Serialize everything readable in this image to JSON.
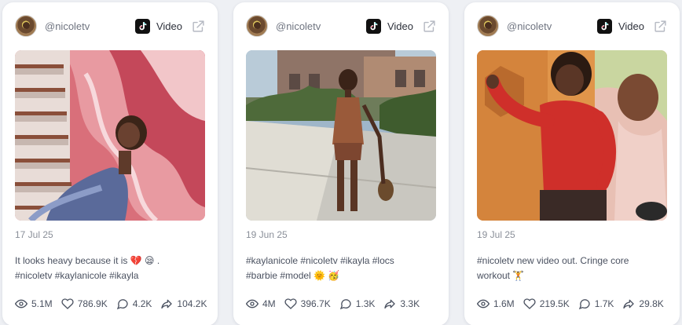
{
  "cards": [
    {
      "username": "@nicoletv",
      "platform": "Video",
      "platform_icon": "tiktok-icon",
      "date": "17 Jul 25",
      "caption_line1": "It looks heavy because it is 💔 😪 .",
      "caption_line2": "#nicoletv #kaylanicole #ikayla",
      "views": "5.1M",
      "likes": "786.9K",
      "comments": "4.2K",
      "shares": "104.2K"
    },
    {
      "username": "@nicoletv",
      "platform": "Video",
      "platform_icon": "tiktok-icon",
      "date": "19 Jun 25",
      "caption_line1": "#kaylanicole #nicoletv #ikayla #locs",
      "caption_line2": "#barbie #model 🌞 🥳",
      "views": "4M",
      "likes": "396.7K",
      "comments": "1.3K",
      "shares": "3.3K"
    },
    {
      "username": "@nicoletv",
      "platform": "Video",
      "platform_icon": "tiktok-icon",
      "date": "19 Jul 25",
      "caption_line1": "#nicoletv new video out. Cringe core",
      "caption_line2": "workout 🏋️",
      "views": "1.6M",
      "likes": "219.5K",
      "comments": "1.7K",
      "shares": "29.8K"
    }
  ],
  "colors": {
    "background": "#eef0f4",
    "card": "#ffffff",
    "text": "#4a5160",
    "muted": "#8a8f99"
  }
}
